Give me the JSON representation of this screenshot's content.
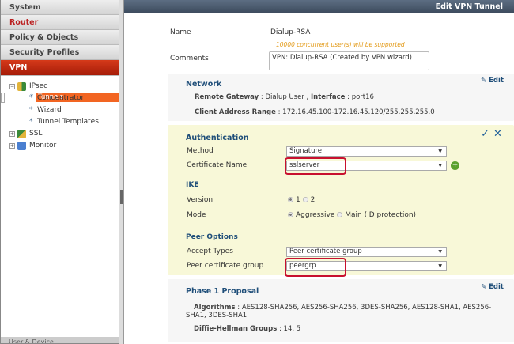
{
  "sidebar": {
    "items": [
      {
        "label": "System"
      },
      {
        "label": "Router"
      },
      {
        "label": "Policy & Objects"
      },
      {
        "label": "Security Profiles"
      },
      {
        "label": "VPN"
      }
    ],
    "tree": {
      "ipsec": "IPsec",
      "children": [
        "Tunnels",
        "Concentrator",
        "Wizard",
        "Tunnel Templates"
      ],
      "ssl": "SSL",
      "monitor": "Monitor"
    },
    "footer": "User & Device"
  },
  "header": {
    "title": "Edit VPN Tunnel"
  },
  "form": {
    "name_label": "Name",
    "name_value": "Dialup-RSA",
    "notice": "10000 concurrent user(s) will be supported",
    "comments_label": "Comments",
    "comments_value": "VPN: Dialup-RSA (Created by VPN wizard)"
  },
  "network": {
    "title": "Network",
    "edit": "Edit",
    "remote_gateway_label": "Remote Gateway",
    "remote_gateway": "Dialup User",
    "interface_label": "Interface",
    "interface": "port16",
    "client_range_label": "Client Address Range",
    "client_range": "172.16.45.100-172.16.45.120/255.255.255.0"
  },
  "auth": {
    "title": "Authentication",
    "method_label": "Method",
    "method": "Signature",
    "cert_label": "Certificate Name",
    "cert": "sslserver",
    "ike_title": "IKE",
    "version_label": "Version",
    "version_options": [
      "1",
      "2"
    ],
    "version_selected": "1",
    "mode_label": "Mode",
    "mode_options": [
      "Aggressive",
      "Main (ID protection)"
    ],
    "mode_selected": "Aggressive",
    "peer_title": "Peer Options",
    "accept_label": "Accept Types",
    "accept": "Peer certificate group",
    "peer_group_label": "Peer certificate group",
    "peer_group": "peergrp"
  },
  "phase1": {
    "title": "Phase 1 Proposal",
    "edit": "Edit",
    "algorithms_label": "Algorithms",
    "algorithms": "AES128-SHA256, AES256-SHA256, 3DES-SHA256, AES128-SHA1, AES256-SHA1, 3DES-SHA1",
    "dh_label": "Diffie-Hellman Groups",
    "dh": "14, 5"
  },
  "colors": {
    "vpn_active": "#b3200c",
    "selected_item": "#f26522",
    "auth_bg": "#f8f8d8",
    "highlight": "#c8102e",
    "header": "#4a586b"
  }
}
